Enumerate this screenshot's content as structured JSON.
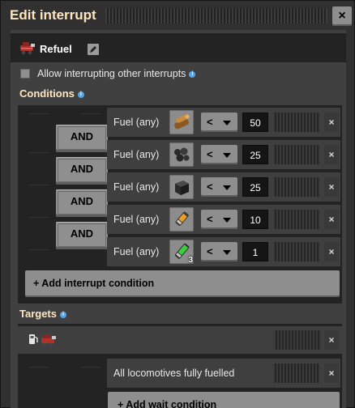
{
  "window": {
    "title": "Edit interrupt",
    "close_label": "×"
  },
  "interrupt": {
    "name": "Refuel"
  },
  "options": {
    "allow_interrupting_label": "Allow interrupting other interrupts",
    "allow_interrupting_checked": false
  },
  "conditions": {
    "title": "Conditions",
    "connectors": [
      "AND",
      "AND",
      "AND",
      "AND"
    ],
    "rows": [
      {
        "label": "Fuel (any)",
        "item_icon": "wood-icon",
        "item_count": "",
        "comparator": "<",
        "value": "50",
        "remove": "×"
      },
      {
        "label": "Fuel (any)",
        "item_icon": "coal-icon",
        "item_count": "",
        "comparator": "<",
        "value": "25",
        "remove": "×"
      },
      {
        "label": "Fuel (any)",
        "item_icon": "solid-fuel-icon",
        "item_count": "",
        "comparator": "<",
        "value": "25",
        "remove": "×"
      },
      {
        "label": "Fuel (any)",
        "item_icon": "rocket-fuel-icon",
        "item_count": "",
        "comparator": "<",
        "value": "10",
        "remove": "×"
      },
      {
        "label": "Fuel (any)",
        "item_icon": "nuclear-fuel-icon",
        "item_count": "3",
        "comparator": "<",
        "value": "1",
        "remove": "×"
      }
    ],
    "add_label": "+ Add interrupt condition"
  },
  "targets": {
    "title": "Targets",
    "target_icons": [
      "fuel-station-icon",
      "locomotive-icon"
    ],
    "remove": "×",
    "wait_condition": {
      "label": "All locomotives fully fuelled",
      "remove": "×"
    },
    "add_wait_label": "+ Add wait condition"
  },
  "colors": {
    "title": "#ffe6c0",
    "info": "#59a6e6",
    "button": "#8e8e8e",
    "panel": "#414040",
    "dark": "#242324"
  }
}
